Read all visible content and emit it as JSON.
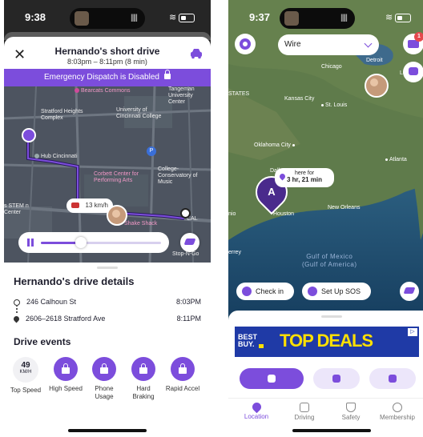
{
  "left": {
    "status": {
      "time": "9:38"
    },
    "drive": {
      "title": "Hernando's short drive",
      "subtitle": "8:03pm – 8:11pm (8 min)"
    },
    "dispatch_banner": "Emergency Dispatch is Disabled",
    "map_labels": {
      "bearcats": "Bearcats Commons",
      "tangeman": "Tangeman University Center",
      "stratford": "Stratford Heights Complex",
      "uc": "University of Cincinnati College",
      "hub": "Hub Cincinnati",
      "corbett": "Corbett Center for Performing Arts",
      "conservatory": "College-Conservatory of Music",
      "stem": "s STEM n Center",
      "shake": "Shake Shack",
      "stop": "Stop-N-Go",
      "cal": "CAL"
    },
    "speed_bubble": "13 km/h",
    "playback": {
      "progress": 0.33
    },
    "details_title": "Hernando's drive details",
    "stops": [
      {
        "address": "246 Calhoun St",
        "time": "8:03PM"
      },
      {
        "address": "2606–2618 Stratford Ave",
        "time": "8:11PM"
      }
    ],
    "events_title": "Drive events",
    "top_speed": {
      "value": "49",
      "unit": "KM/H",
      "label": "Top Speed"
    },
    "events": [
      {
        "label": "High Speed"
      },
      {
        "label": "Phone Usage"
      },
      {
        "label": "Hard Braking"
      },
      {
        "label": "Rapid Accel"
      }
    ]
  },
  "right": {
    "status": {
      "time": "9:37"
    },
    "circle_select": "Wire",
    "mail_badge": "1",
    "cities": {
      "chicago": "Chicago",
      "detroit": "Detroit",
      "london": "London",
      "kansas": "Kansas City",
      "stlouis": "St. Louis",
      "states": "STATES",
      "okc": "Oklahoma City",
      "dallas": "Dallas",
      "atlanta": "Atlanta",
      "houston": "Houston",
      "neworleans": "New Orleans",
      "nio": "nio",
      "errey": "errey"
    },
    "gulf_label": {
      "line1": "Gulf of Mexico",
      "line2": "(Gulf of America)"
    },
    "marker_letter": "A",
    "here_bubble": {
      "line1": "here for",
      "line2": "3 hr, 21 min"
    },
    "buttons": {
      "checkin": "Check in",
      "sos": "Set Up SOS"
    },
    "ad": {
      "logo_line1": "BEST",
      "logo_line2": "BUY.",
      "headline": "TOP DEALS",
      "close": "▷"
    },
    "tabs": [
      {
        "label": "Location"
      },
      {
        "label": "Driving"
      },
      {
        "label": "Safety"
      },
      {
        "label": "Membership"
      }
    ]
  }
}
